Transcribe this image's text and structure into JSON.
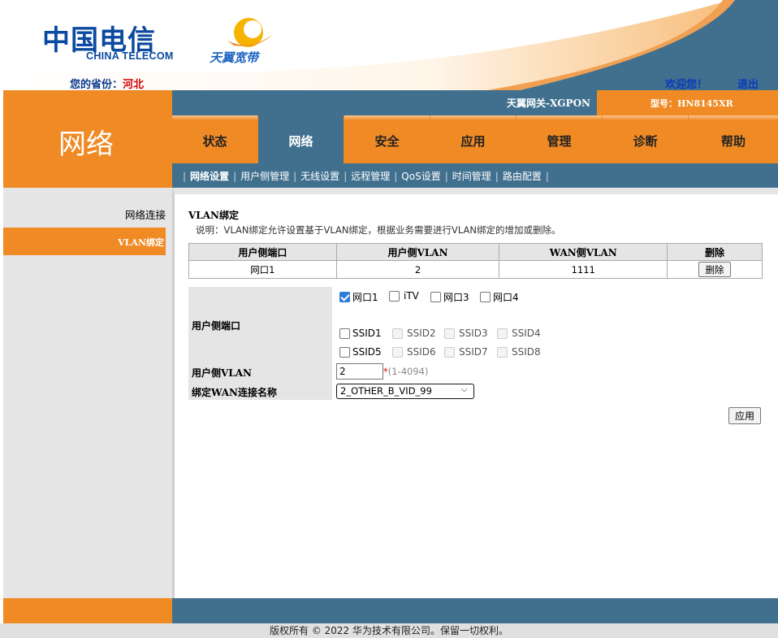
{
  "header": {
    "brand_cn": "中国电信",
    "brand_en": "CHINA TELECOM",
    "broadband_brand": "天翼宽带",
    "province_label": "您的省份：",
    "province_value": "河北",
    "welcome": "欢迎您！",
    "logout": "退出",
    "gateway_name": "天翼网关-XGPON",
    "model_label": "型号：HN8145XR"
  },
  "section_title": "网络",
  "tabs": [
    {
      "label": "状态"
    },
    {
      "label": "网络"
    },
    {
      "label": "安全"
    },
    {
      "label": "应用"
    },
    {
      "label": "管理"
    },
    {
      "label": "诊断"
    },
    {
      "label": "帮助"
    }
  ],
  "subnav": [
    {
      "label": "网络设置"
    },
    {
      "label": "用户侧管理"
    },
    {
      "label": "无线设置"
    },
    {
      "label": "远程管理"
    },
    {
      "label": "QoS设置"
    },
    {
      "label": "时间管理"
    },
    {
      "label": "路由配置"
    }
  ],
  "sidebar": {
    "items": [
      {
        "label": "网络连接"
      },
      {
        "label": "VLAN绑定"
      }
    ]
  },
  "page": {
    "heading": "VLAN绑定",
    "description": "说明：VLAN绑定允许设置基于VLAN绑定，根据业务需要进行VLAN绑定的增加或删除。"
  },
  "table": {
    "headers": [
      "用户侧端口",
      "用户侧VLAN",
      "WAN侧VLAN",
      "删除"
    ],
    "rows": [
      {
        "port": "网口1",
        "user_vlan": "2",
        "wan_vlan": "1111",
        "delete_label": "删除"
      }
    ]
  },
  "form": {
    "port_label": "用户侧端口",
    "lan_ports": [
      {
        "label": "网口1",
        "checked": true
      },
      {
        "label": "iTV",
        "checked": false
      },
      {
        "label": "网口3",
        "checked": false
      },
      {
        "label": "网口4",
        "checked": false
      }
    ],
    "ssids": [
      {
        "label": "SSID1",
        "enabled": true
      },
      {
        "label": "SSID2",
        "enabled": false
      },
      {
        "label": "SSID3",
        "enabled": false
      },
      {
        "label": "SSID4",
        "enabled": false
      },
      {
        "label": "SSID5",
        "enabled": true
      },
      {
        "label": "SSID6",
        "enabled": false
      },
      {
        "label": "SSID7",
        "enabled": false
      },
      {
        "label": "SSID8",
        "enabled": false
      }
    ],
    "user_vlan_label": "用户侧VLAN",
    "user_vlan_value": "2",
    "user_vlan_hint_star": "*",
    "user_vlan_hint": "(1-4094)",
    "wan_label": "绑定WAN连接名称",
    "wan_selected": "2_OTHER_B_VID_99",
    "apply_label": "应用"
  },
  "footer": {
    "copyright": "版权所有 © 2022 华为技术有限公司。保留一切权利。"
  },
  "colors": {
    "orange": "#f08a24",
    "steel_blue": "#41708f",
    "panel_gray": "#e5e5e5",
    "brand_blue": "#0b4aa0",
    "province_red": "#d00000"
  }
}
